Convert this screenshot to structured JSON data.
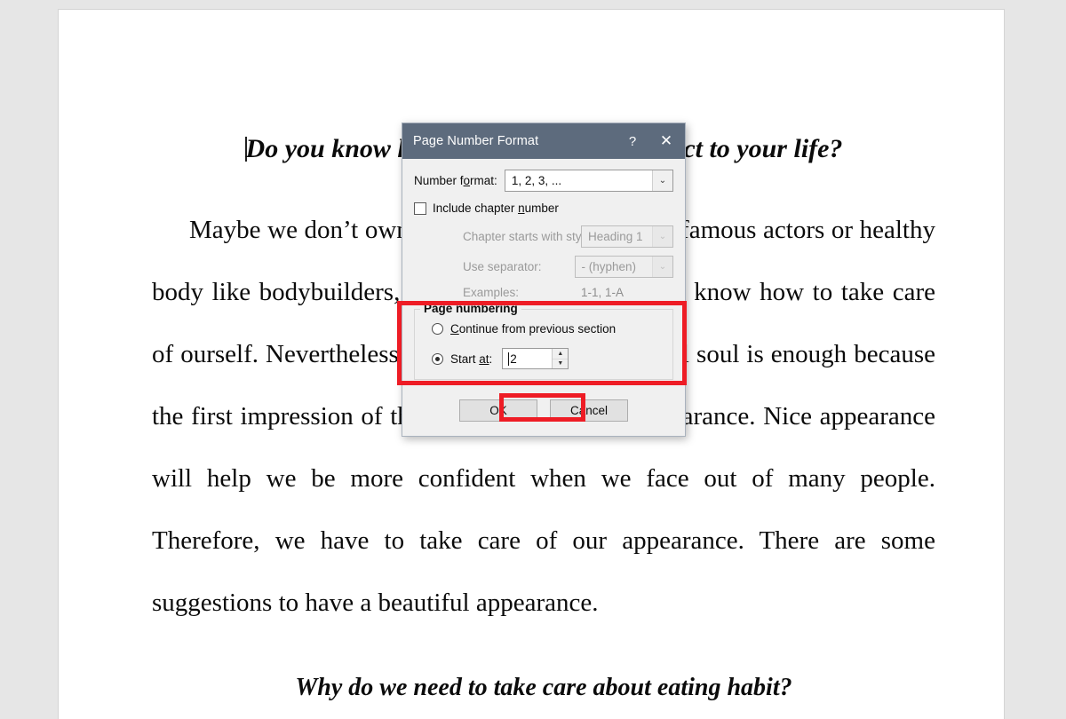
{
  "document": {
    "heading_1": "Do you know how your appearance affect to your life?",
    "heading_1_visible_left": "Do you know how",
    "heading_1_visible_right": "affect to your life?",
    "paragraph_1": "Maybe we don’t own a perfect appearance like famous actors or healthy body like bodybuilders, but it doesn’t matter if we know how to take care of ourself. Nevertheless, don’t think that a beautiful soul is enough because the first impression of the other people is our appearance. Nice appearance will help we be more confident when we face out of many people. Therefore, we have to take care of our appearance. There are some suggestions to have a beautiful appearance.",
    "heading_2": "Why do we need to take care about eating habit?"
  },
  "dialog": {
    "title": "Page Number Format",
    "help_icon": "?",
    "close_icon": "✕",
    "number_format": {
      "label": "Number format:",
      "value": "1, 2, 3, ...",
      "arrow_icon": "⌄"
    },
    "include_chapter_number": {
      "label_before": "Include chapter ",
      "label_underlined": "n",
      "label_after": "umber",
      "checked": false
    },
    "chapter_starts_with_style": {
      "label": "Chapter starts with style:",
      "value": "Heading 1",
      "disabled": true,
      "arrow_icon": "⌄"
    },
    "use_separator": {
      "label": "Use separator:",
      "value": "-   (hyphen)",
      "disabled": true,
      "arrow_icon": "⌄"
    },
    "examples": {
      "label": "Examples:",
      "value": "1-1, 1-A"
    },
    "page_numbering": {
      "legend": "Page numbering",
      "continue_option": {
        "label_underlined": "C",
        "label_rest": "ontinue from previous section",
        "selected": false
      },
      "start_at_option": {
        "label_before": "Start ",
        "label_underlined": "at",
        "label_after": ":",
        "selected": true,
        "value": "2",
        "spin_up_icon": "▲",
        "spin_down_icon": "▼"
      }
    },
    "buttons": {
      "ok": "OK",
      "cancel": "Cancel"
    }
  },
  "annotations": {
    "highlight_color": "#ee1c25",
    "boxes": [
      {
        "name": "page-numbering-highlight"
      },
      {
        "name": "ok-button-highlight"
      }
    ]
  },
  "theme": {
    "titlebar_color": "#5d6b7d",
    "dialog_bg": "#f0f0f0",
    "canvas_bg": "#e6e6e6",
    "page_bg": "#ffffff"
  }
}
